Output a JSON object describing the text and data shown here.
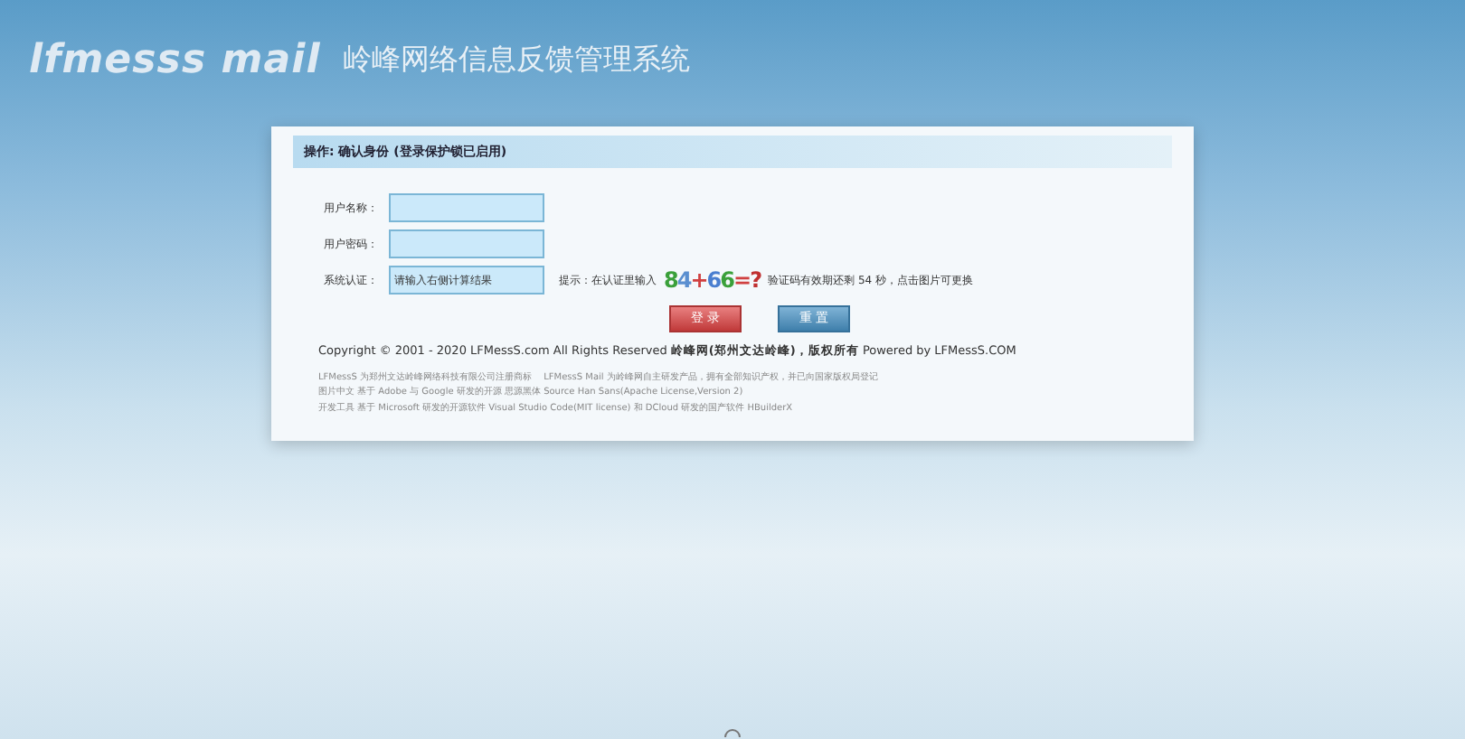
{
  "header": {
    "logo": "lfmesss mail",
    "title": "岭峰网络信息反馈管理系统"
  },
  "panel": {
    "title": "操作: 确认身份 (登录保护锁已启用)",
    "fields": [
      {
        "label": "用户名称：",
        "kind": "text"
      },
      {
        "label": "用户密码：",
        "kind": "password"
      },
      {
        "label": "系统认证：",
        "kind": "captcha",
        "placeholder": "请输入右侧计算结果",
        "hint": "提示：在认证里输入",
        "captcha": "84+66=?",
        "note": "验证码有效期还剩 54 秒，点击图片可更换"
      }
    ],
    "buttons": [
      {
        "label": "登 录",
        "kind": "primary"
      },
      {
        "label": "重 置",
        "kind": "secondary"
      }
    ],
    "copyright": "Copyright © 2001 - 2020 LFMessS.com All Rights Reserved **岭峰网(郑州文达岭峰)，版权所有** Powered by LFMessS.COM",
    "notes": [
      "LFMessS 为郑州文达岭峰网络科技有限公司注册商标　 LFMessS Mail 为岭峰网自主研发产品，拥有全部知识产权，并已向国家版权局登记",
      "图片中文 基于 Adobe 与 Google 研发的开源 思源黑体 Source Han Sans(Apache License,Version 2)",
      "开发工具 基于 Microsoft 研发的开源软件 Visual Studio Code(MIT license) 和 DCloud 研发的国产软件 HBuilderX"
    ]
  }
}
